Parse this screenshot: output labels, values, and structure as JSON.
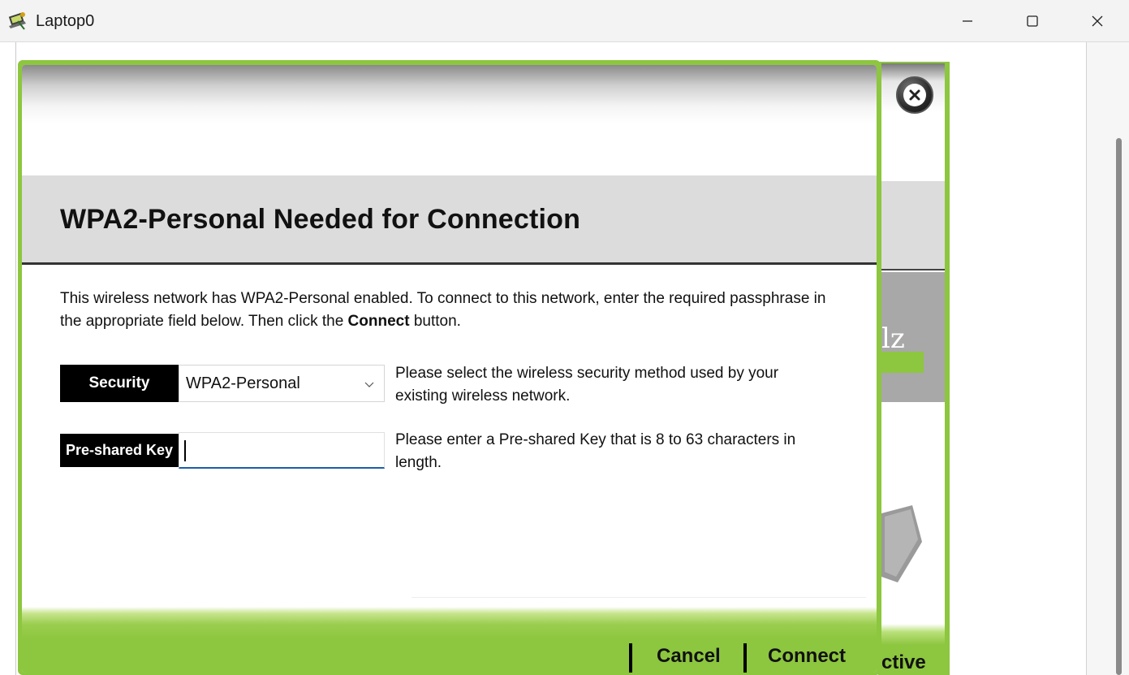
{
  "window": {
    "title": "Laptop0",
    "app_icon": "packet-tracer-laptop-icon",
    "controls": [
      "minimize-icon",
      "maximize-icon",
      "close-icon"
    ]
  },
  "dialog": {
    "title": "WPA2-Personal Needed for Connection",
    "description_part1": "This wireless network has WPA2-Personal enabled. To connect to this network, enter the required passphrase in the appropriate field below. Then click the ",
    "description_bold": "Connect",
    "description_part2": " button.",
    "security": {
      "label": "Security",
      "selected": "WPA2-Personal",
      "hint": "Please select the wireless security method used by your existing wireless network."
    },
    "psk": {
      "label": "Pre-shared Key",
      "value": "",
      "hint": "Please enter a Pre-shared Key that is 8 to 63 characters in length."
    },
    "footer": {
      "cancel_label": "Cancel",
      "connect_label": "Connect"
    }
  },
  "background_panel": {
    "fragment_text": "lz",
    "status_fragment": "ctive"
  },
  "colors": {
    "accent_green": "#8dc63f",
    "header_gray": "#dcdcdc",
    "label_black": "#000000"
  }
}
